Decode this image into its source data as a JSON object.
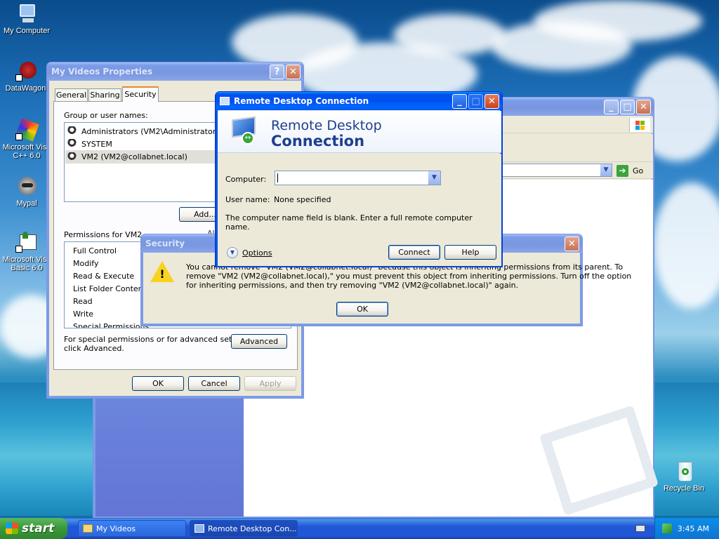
{
  "desktop": {
    "icons": [
      {
        "label": "My Computer"
      },
      {
        "label": "DataWagon."
      },
      {
        "label": "Microsoft Visu C++ 6.0"
      },
      {
        "label": "Mypal"
      },
      {
        "label": "Microsoft Visu Basic 6.0"
      },
      {
        "label": "Recycle Bin"
      }
    ]
  },
  "explorer": {
    "address_go": "Go"
  },
  "properties": {
    "title": "My Videos Properties",
    "tabs": [
      "General",
      "Sharing",
      "Security"
    ],
    "active_tab": "Security",
    "group_label": "Group or user names:",
    "users": [
      "Administrators (VM2\\Administrators)",
      "SYSTEM",
      "VM2 (VM2@collabnet.local)"
    ],
    "selected_user": "VM2 (VM2@collabnet.local)",
    "add_button": "Add...",
    "permissions_label": "Permissions for VM2",
    "permissions_col": "All",
    "permissions": [
      "Full Control",
      "Modify",
      "Read & Execute",
      "List Folder Contents",
      "Read",
      "Write",
      "Special Permissions"
    ],
    "advanced_text_1": "For special permissions or for advanced settings,",
    "advanced_text_2": "click Advanced.",
    "advanced_button": "Advanced",
    "ok": "OK",
    "cancel": "Cancel",
    "apply": "Apply"
  },
  "security_dialog": {
    "title": "Security",
    "line1": "You cannot remove \"VM2 (VM2@collabnet.local)\" because this object is inheriting permissions from its parent. To",
    "line2": "remove \"VM2 (VM2@collabnet.local),\" you must prevent this object from inheriting permissions.  Turn off the option",
    "line3": "for inheriting permissions, and then try removing \"VM2 (VM2@collabnet.local)\" again.",
    "ok": "OK"
  },
  "rdc": {
    "title": "Remote Desktop Connection",
    "banner_line1": "Remote Desktop",
    "banner_line2": "Connection",
    "computer_label": "Computer:",
    "computer_value": "",
    "user_label": "User name:",
    "user_value": "None specified",
    "info_line1": "The computer name field is blank. Enter a full remote computer",
    "info_line2": "name.",
    "options": "Options",
    "connect": "Connect",
    "help": "Help"
  },
  "taskbar": {
    "start": "start",
    "items": [
      "My Videos",
      "Remote Desktop Con..."
    ],
    "clock": "3:45 AM"
  }
}
